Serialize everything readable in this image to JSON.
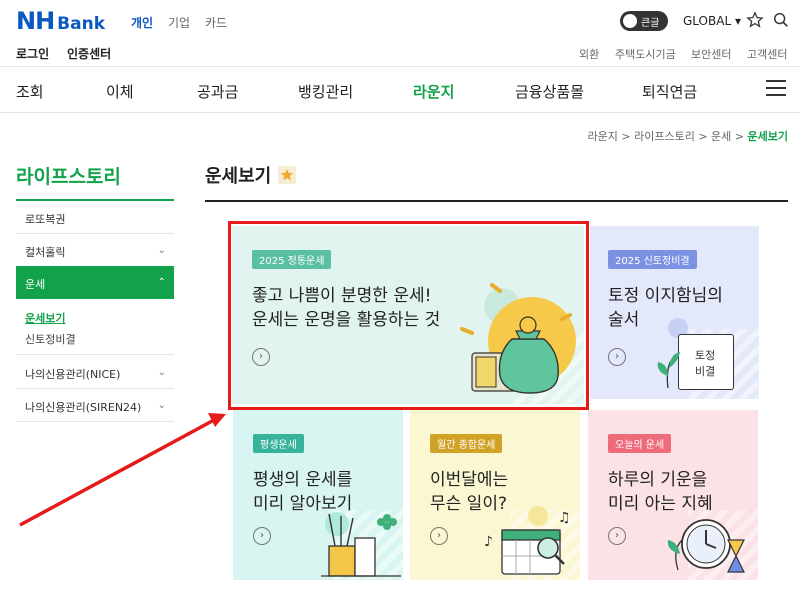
{
  "header": {
    "logo_main": "NH",
    "logo_sub": "Bank",
    "segments": [
      "개인",
      "기업",
      "카드"
    ],
    "toggle_label": "큰글",
    "global_label": "GLOBAL ▾",
    "login": "로그인",
    "cert": "인증센터",
    "utility_links": [
      "외환",
      "주택도시기금",
      "보안센터",
      "고객센터"
    ]
  },
  "nav": {
    "items": [
      "조회",
      "이체",
      "공과금",
      "뱅킹관리",
      "라운지",
      "금융상품몰",
      "퇴직연금"
    ],
    "active": "라운지"
  },
  "breadcrumb": {
    "path": "라운지 > 라이프스토리 > 운세 > ",
    "current": "운세보기"
  },
  "sidebar": {
    "title": "라이프스토리",
    "items": [
      {
        "label": "로또복권",
        "chevron": ""
      },
      {
        "label": "컬처홀릭",
        "chevron": "⌄"
      },
      {
        "label": "운세",
        "chevron": "⌃"
      },
      {
        "label": "나의신용관리(NICE)",
        "chevron": "⌄"
      },
      {
        "label": "나의신용관리(SIREN24)",
        "chevron": "⌄"
      }
    ],
    "sub_items": [
      "운세보기",
      "신토정비결"
    ]
  },
  "main": {
    "title": "운세보기",
    "cards": [
      {
        "badge": "2025 정통운세",
        "title": "좋고 나쁨이 분명한 운세!\n운세는 운명을 활용하는 것",
        "badge_color": "#5bbfa4",
        "bg": "#e2f4ef"
      },
      {
        "badge": "2025 신토정비결",
        "title": "토정 이지함님의\n술서",
        "badge_color": "#7b92e3",
        "bg": "#e3e8fb",
        "icon_text_1": "토정",
        "icon_text_2": "비결"
      },
      {
        "badge": "평생운세",
        "title": "평생의 운세를\n미리 알아보기",
        "badge_color": "#36b39a",
        "bg": "#d9f5f1"
      },
      {
        "badge": "월간 종합운세",
        "title": "이번달에는\n무슨 일이?",
        "badge_color": "#d2a227",
        "bg": "#fbf7d3"
      },
      {
        "badge": "오늘의 운세",
        "title": "하루의 기운을\n미리 아는 지혜",
        "badge_color": "#ee6b7c",
        "bg": "#fbe2e6"
      }
    ],
    "arrow_glyph": "›"
  },
  "annotation": {
    "highlight_color": "#e51a1a"
  }
}
